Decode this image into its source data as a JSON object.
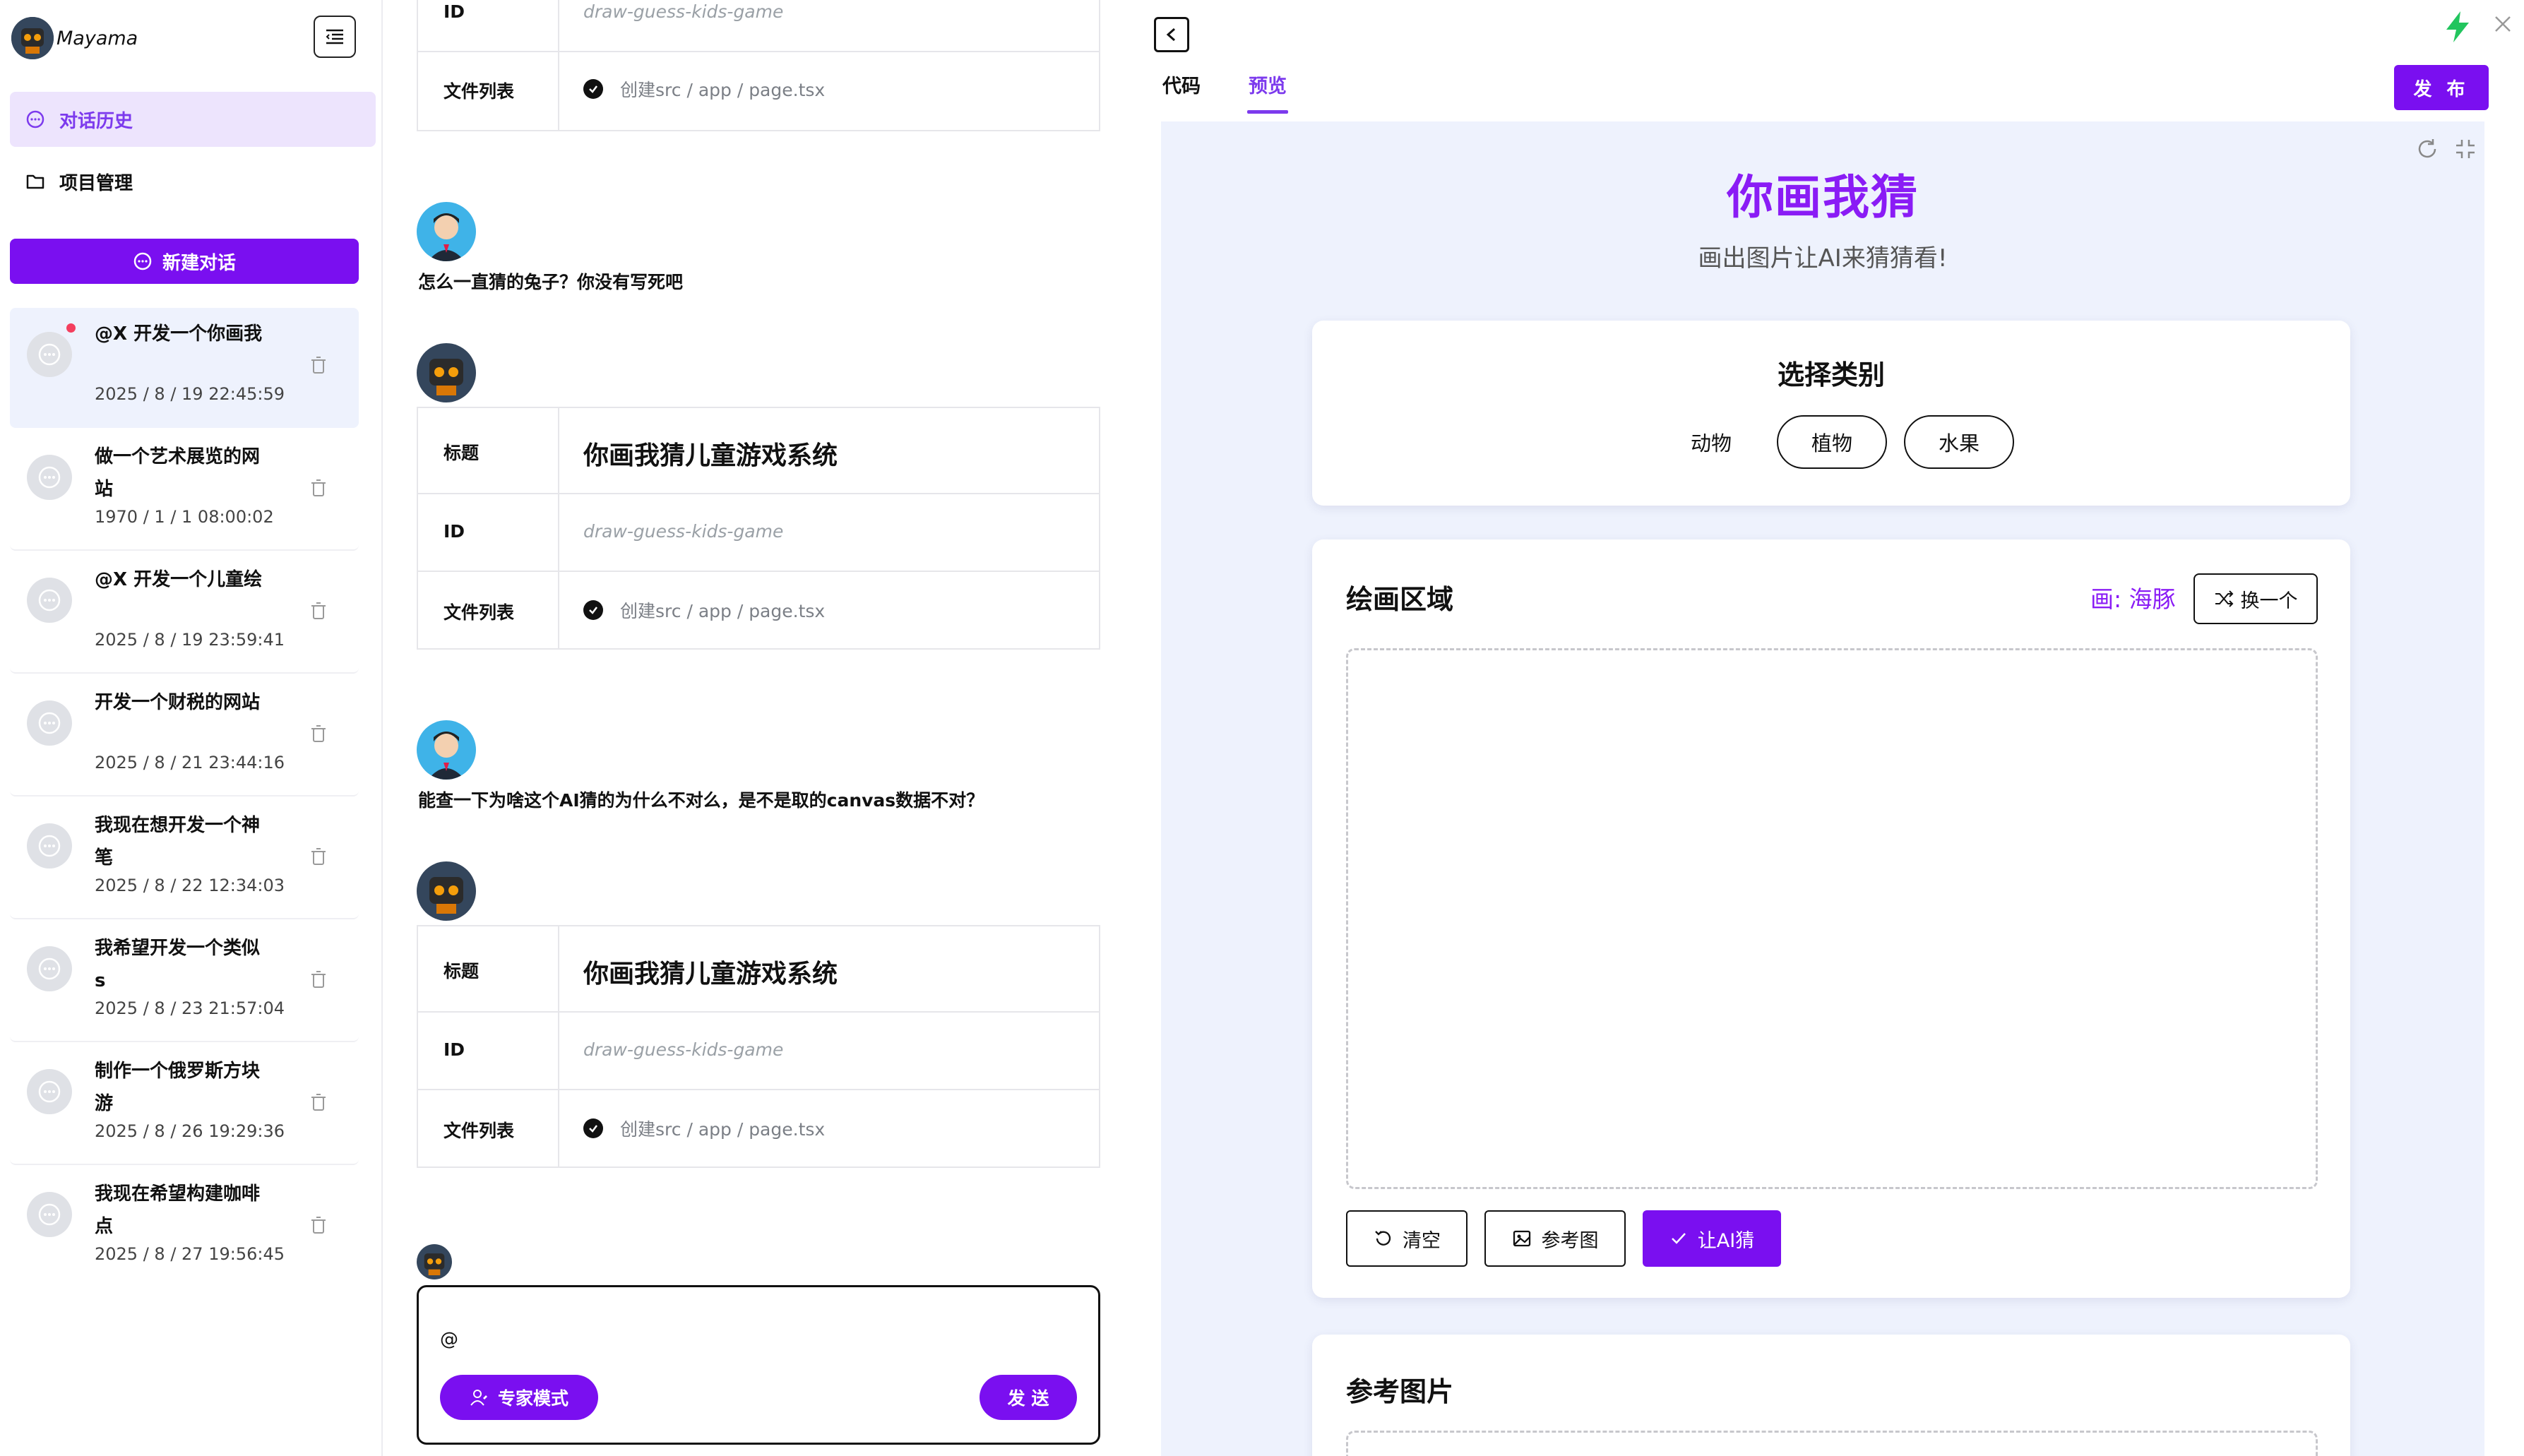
{
  "sidebar": {
    "brand": "Mayama",
    "nav": [
      {
        "label": "对话历史"
      },
      {
        "label": "项目管理"
      }
    ],
    "new_chat_label": "新建对话",
    "history": [
      {
        "title": "@X 开发一个你画我",
        "time": "2025 / 8 / 19 22:45:59"
      },
      {
        "title": "做一个艺术展览的网站",
        "time": "1970 / 1 / 1 08:00:02"
      },
      {
        "title": "@X 开发一个儿童绘",
        "time": "2025 / 8 / 19 23:59:41"
      },
      {
        "title": "开发一个财税的网站",
        "time": "2025 / 8 / 21 23:44:16"
      },
      {
        "title": "我现在想开发一个神笔",
        "time": "2025 / 8 / 22 12:34:03"
      },
      {
        "title": "我希望开发一个类似s",
        "time": "2025 / 8 / 23 21:57:04"
      },
      {
        "title": "制作一个俄罗斯方块游",
        "time": "2025 / 8 / 26 19:29:36"
      },
      {
        "title": "我现在希望构建咖啡点",
        "time": "2025 / 8 / 27 19:56:45"
      }
    ]
  },
  "chat": {
    "labels": {
      "title": "标题",
      "id": "ID",
      "files": "文件列表"
    },
    "project": {
      "title": "你画我猜儿童游戏系统",
      "id": "draw-guess-kids-game",
      "file": "创建src / app / page.tsx"
    },
    "user_messages": [
      "怎么一直猜的兔子？你没有写死吧",
      "能查一下为啥这个AI猜的为什么不对么，是不是取的canvas数据不对？"
    ],
    "composer": {
      "value": "@",
      "expert_label": "专家模式",
      "send_label": "发 送"
    }
  },
  "right": {
    "tabs": [
      {
        "label": "代码"
      },
      {
        "label": "预览"
      }
    ],
    "publish_label": "发 布",
    "preview": {
      "title": "你画我猜",
      "subtitle": "画出图片让AI来猜猜看!",
      "category_title": "选择类别",
      "categories": [
        "动物",
        "植物",
        "水果"
      ],
      "draw_section_title": "绘画区域",
      "draw_word": "画: 海豚",
      "swap_label": "换一个",
      "clear_label": "清空",
      "reference_label": "参考图",
      "guess_label": "让AI猜",
      "reference_section_title": "参考图片"
    }
  },
  "colors": {
    "accent": "#7a0ff0",
    "accent_text": "#8a1cf5",
    "active_nav_bg": "#ede4fd",
    "preview_bg": "#eef2fd",
    "bolt": "#22c55e",
    "badge": "#f43f5e"
  }
}
